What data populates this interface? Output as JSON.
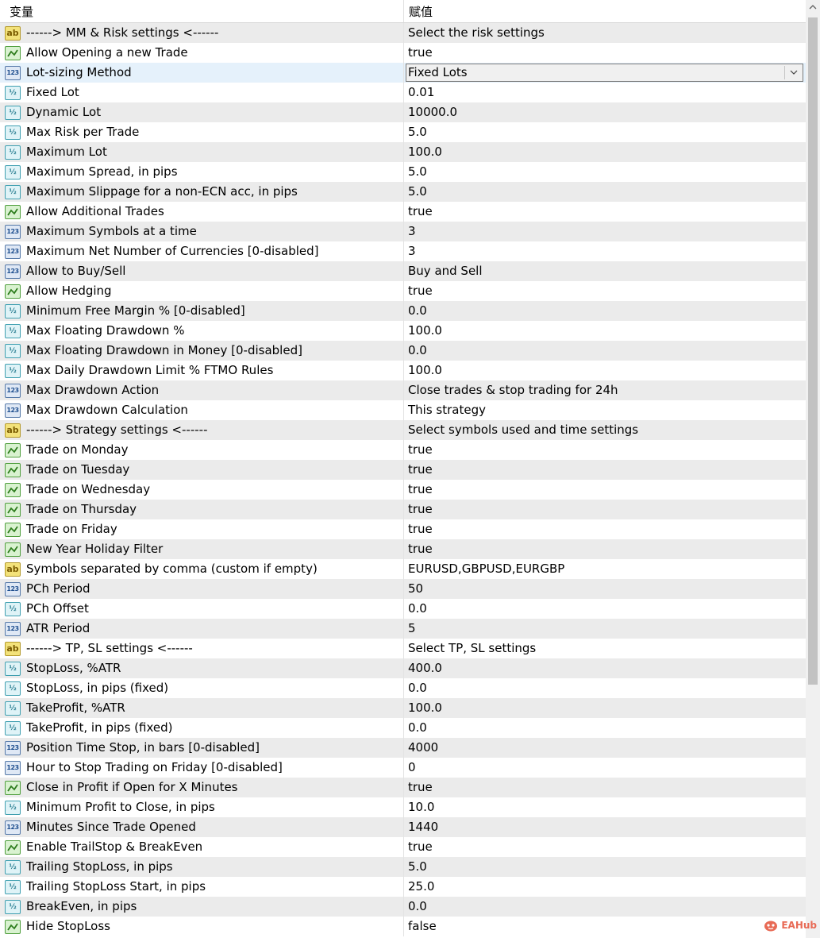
{
  "header": {
    "col_name": "变量",
    "col_value": "赋值"
  },
  "rows": [
    {
      "icon": "ab",
      "name": "------> MM & Risk settings <------",
      "value": "Select the risk settings"
    },
    {
      "icon": "bool",
      "name": "Allow Opening a new Trade",
      "value": "true"
    },
    {
      "icon": "int",
      "name": "Lot-sizing Method",
      "value": "Fixed Lots",
      "selected": true
    },
    {
      "icon": "dbl",
      "name": "Fixed Lot",
      "value": "0.01"
    },
    {
      "icon": "dbl",
      "name": "Dynamic Lot",
      "value": "10000.0"
    },
    {
      "icon": "dbl",
      "name": "Max Risk per Trade",
      "value": "5.0"
    },
    {
      "icon": "dbl",
      "name": "Maximum Lot",
      "value": "100.0"
    },
    {
      "icon": "dbl",
      "name": "Maximum Spread, in pips",
      "value": "5.0"
    },
    {
      "icon": "dbl",
      "name": "Maximum Slippage for a non-ECN acc, in pips",
      "value": "5.0"
    },
    {
      "icon": "bool",
      "name": "Allow Additional Trades",
      "value": "true"
    },
    {
      "icon": "int",
      "name": "Maximum Symbols at a time",
      "value": "3"
    },
    {
      "icon": "int",
      "name": "Maximum Net Number of Currencies [0-disabled]",
      "value": "3"
    },
    {
      "icon": "int",
      "name": "Allow to Buy/Sell",
      "value": "Buy and Sell"
    },
    {
      "icon": "bool",
      "name": "Allow Hedging",
      "value": "true"
    },
    {
      "icon": "dbl",
      "name": "Minimum Free Margin % [0-disabled]",
      "value": "0.0"
    },
    {
      "icon": "dbl",
      "name": "Max Floating Drawdown %",
      "value": "100.0"
    },
    {
      "icon": "dbl",
      "name": "Max Floating Drawdown in Money [0-disabled]",
      "value": "0.0"
    },
    {
      "icon": "dbl",
      "name": "Max Daily Drawdown Limit % FTMO Rules",
      "value": "100.0"
    },
    {
      "icon": "int",
      "name": "Max Drawdown Action",
      "value": "Close trades & stop trading for 24h"
    },
    {
      "icon": "int",
      "name": "Max Drawdown Calculation",
      "value": "This strategy"
    },
    {
      "icon": "ab",
      "name": "------> Strategy settings <------",
      "value": "Select symbols used and time settings"
    },
    {
      "icon": "bool",
      "name": "Trade on Monday",
      "value": "true"
    },
    {
      "icon": "bool",
      "name": "Trade on Tuesday",
      "value": "true"
    },
    {
      "icon": "bool",
      "name": "Trade on Wednesday",
      "value": "true"
    },
    {
      "icon": "bool",
      "name": "Trade on Thursday",
      "value": "true"
    },
    {
      "icon": "bool",
      "name": "Trade on Friday",
      "value": "true"
    },
    {
      "icon": "bool",
      "name": "New Year Holiday Filter",
      "value": "true"
    },
    {
      "icon": "ab",
      "name": "Symbols separated by comma (custom if empty)",
      "value": "EURUSD,GBPUSD,EURGBP"
    },
    {
      "icon": "int",
      "name": "PCh Period",
      "value": "50"
    },
    {
      "icon": "dbl",
      "name": "PCh Offset",
      "value": "0.0"
    },
    {
      "icon": "int",
      "name": "ATR Period",
      "value": "5"
    },
    {
      "icon": "ab",
      "name": "------> TP, SL settings <------",
      "value": "Select TP, SL settings"
    },
    {
      "icon": "dbl",
      "name": "StopLoss, %ATR",
      "value": "400.0"
    },
    {
      "icon": "dbl",
      "name": "StopLoss, in pips (fixed)",
      "value": "0.0"
    },
    {
      "icon": "dbl",
      "name": "TakeProfit, %ATR",
      "value": "100.0"
    },
    {
      "icon": "dbl",
      "name": "TakeProfit, in pips (fixed)",
      "value": "0.0"
    },
    {
      "icon": "int",
      "name": "Position Time Stop, in bars [0-disabled]",
      "value": "4000"
    },
    {
      "icon": "int",
      "name": "Hour to Stop Trading on Friday [0-disabled]",
      "value": "0"
    },
    {
      "icon": "bool",
      "name": "Close in Profit if Open for X Minutes",
      "value": "true"
    },
    {
      "icon": "dbl",
      "name": "Minimum Profit to Close, in pips",
      "value": "10.0"
    },
    {
      "icon": "int",
      "name": "Minutes Since Trade Opened",
      "value": "1440"
    },
    {
      "icon": "bool",
      "name": "Enable TrailStop & BreakEven",
      "value": "true"
    },
    {
      "icon": "dbl",
      "name": "Trailing StopLoss, in pips",
      "value": "5.0"
    },
    {
      "icon": "dbl",
      "name": "Trailing StopLoss Start, in pips",
      "value": "25.0"
    },
    {
      "icon": "dbl",
      "name": "BreakEven, in pips",
      "value": "0.0"
    },
    {
      "icon": "bool",
      "name": "Hide StopLoss",
      "value": "false"
    }
  ],
  "icon_labels": {
    "ab": "ab",
    "int": "123",
    "dbl": "½"
  },
  "icon_names": {
    "ab": "string-type-icon",
    "bool": "boolean-type-icon",
    "int": "integer-type-icon",
    "dbl": "double-type-icon"
  },
  "watermark": {
    "text": "EAHub",
    "icon": "eahub-logo-icon",
    "color": "#e86a55"
  },
  "colors": {
    "row_even": "#ebebeb",
    "row_odd": "#ffffff",
    "selected": "#e5f1fb"
  }
}
